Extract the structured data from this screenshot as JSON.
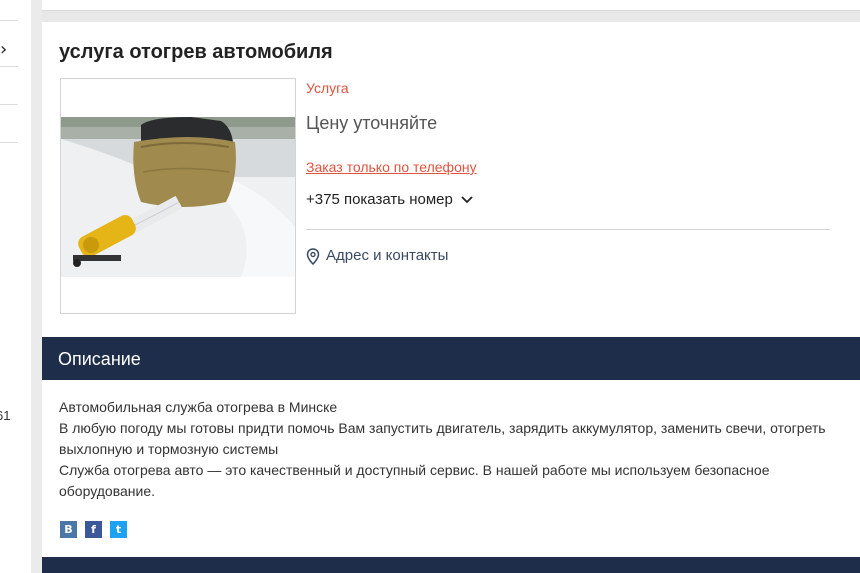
{
  "sidebar": {
    "chevron": "›",
    "partial_number": "61"
  },
  "listing": {
    "title": "услуга отогрев автомобиля",
    "type_label": "Услуга",
    "price": "Цену уточняйте",
    "order_note": "Заказ только по телефону",
    "phone": "+375 показать номер",
    "address_link": "Адрес и контакты"
  },
  "description": {
    "header": "Описание",
    "lines": [
      "Автомобильная служба отогрева в Минске",
      "В любую погоду мы готовы придти помочь Вам запустить двигатель, зарядить аккумулятор, заменить свечи, отогреть выхлопную и тормозную системы",
      "Служба отогрева авто — это качественный и доступный сервис. В нашей работе мы используем безопасное оборудование."
    ]
  },
  "share": {
    "vk": "В",
    "facebook": "f",
    "twitter": "t"
  },
  "colors": {
    "accent": "#e0533f",
    "navy": "#1e2d4a",
    "link": "#3a4a63"
  },
  "icons": [
    "chevron-down-icon",
    "map-pin-icon",
    "vk-icon",
    "facebook-icon",
    "twitter-icon"
  ]
}
